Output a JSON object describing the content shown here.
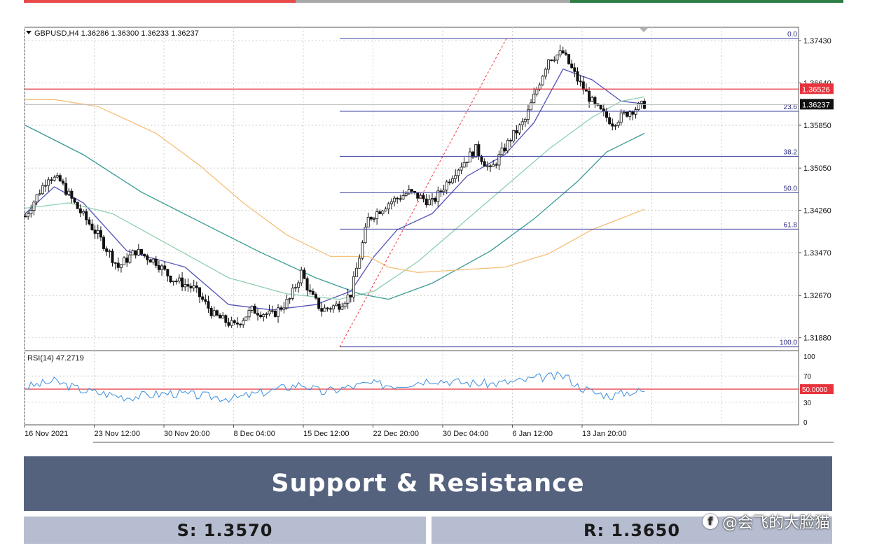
{
  "colors": {
    "top_red": "#e84a4a",
    "top_gray": "#a8a8a8",
    "top_green": "#2e7d46",
    "banner_bg": "#54627e",
    "sr_bg": "#b6bdd0",
    "fib_line": "#3b3fa0",
    "resistance_line": "#e8323c",
    "ma_fast": "#5252b8",
    "ma_mid": "#8ed0b0",
    "ma_slow": "#3a9a94",
    "ma_200": "#f5c07a",
    "rsi_line": "#3d8fdc"
  },
  "chart_data": {
    "type": "candlestick",
    "symbol_header": "GBPUSD,H4  1.36286 1.36300 1.36233 1.36237",
    "price_axis": {
      "ylim": [
        1.3164,
        1.3768
      ],
      "ticks": [
        "1.37430",
        "1.36640",
        "1.35850",
        "1.35050",
        "1.34260",
        "1.33470",
        "1.32670",
        "1.31880"
      ],
      "tick_values": [
        1.3743,
        1.3664,
        1.3585,
        1.3505,
        1.3426,
        1.3347,
        1.3267,
        1.3188
      ]
    },
    "current_price": {
      "label": "1.36237",
      "value": 1.36237
    },
    "horizontal_level": {
      "label": "1.36526",
      "value": 1.36526
    },
    "fibonacci": {
      "high": 1.3747,
      "low": 1.3171,
      "levels": [
        {
          "label": "0.0",
          "ratio": 0.0
        },
        {
          "label": "23.6",
          "ratio": 0.236
        },
        {
          "label": "38.2",
          "ratio": 0.382
        },
        {
          "label": "50.0",
          "ratio": 0.5
        },
        {
          "label": "61.8",
          "ratio": 0.618
        },
        {
          "label": "100.0",
          "ratio": 1.0
        }
      ]
    },
    "time_axis": {
      "labels": [
        "16 Nov 2021",
        "23 Nov 12:00",
        "30 Nov 20:00",
        "8 Dec 04:00",
        "15 Dec 12:00",
        "22 Dec 20:00",
        "30 Dec 04:00",
        "6 Jan 12:00",
        "13 Jan 20:00"
      ]
    },
    "candle_count": 175,
    "close_path": [
      [
        0,
        1.3415
      ],
      [
        8,
        1.349
      ],
      [
        12,
        1.348
      ],
      [
        18,
        1.343
      ],
      [
        25,
        1.338
      ],
      [
        32,
        1.332
      ],
      [
        38,
        1.335
      ],
      [
        45,
        1.333
      ],
      [
        50,
        1.33
      ],
      [
        58,
        1.328
      ],
      [
        65,
        1.323
      ],
      [
        72,
        1.321
      ],
      [
        78,
        1.324
      ],
      [
        85,
        1.323
      ],
      [
        91,
        1.326
      ],
      [
        95,
        1.331
      ],
      [
        98,
        1.327
      ],
      [
        102,
        1.324
      ],
      [
        108,
        1.325
      ],
      [
        112,
        1.327
      ],
      [
        118,
        1.341
      ],
      [
        125,
        1.344
      ],
      [
        132,
        1.346
      ],
      [
        140,
        1.344
      ],
      [
        148,
        1.35
      ],
      [
        155,
        1.354
      ],
      [
        160,
        1.35
      ],
      [
        167,
        1.356
      ],
      [
        172,
        1.3595
      ],
      [
        180,
        1.371
      ],
      [
        185,
        1.372
      ],
      [
        190,
        1.367
      ],
      [
        196,
        1.362
      ],
      [
        202,
        1.359
      ],
      [
        208,
        1.3612
      ],
      [
        213,
        1.3624
      ]
    ],
    "moving_averages": [
      {
        "key": "ma_fast",
        "points": [
          [
            0,
            1.342
          ],
          [
            10,
            1.347
          ],
          [
            20,
            1.344
          ],
          [
            35,
            1.335
          ],
          [
            55,
            1.332
          ],
          [
            70,
            1.325
          ],
          [
            85,
            1.324
          ],
          [
            100,
            1.325
          ],
          [
            112,
            1.3275
          ],
          [
            120,
            1.334
          ],
          [
            128,
            1.339
          ],
          [
            140,
            1.342
          ],
          [
            152,
            1.349
          ],
          [
            165,
            1.353
          ],
          [
            175,
            1.359
          ],
          [
            185,
            1.369
          ],
          [
            195,
            1.367
          ],
          [
            205,
            1.363
          ],
          [
            213,
            1.3625
          ]
        ]
      },
      {
        "key": "ma_mid",
        "points": [
          [
            0,
            1.343
          ],
          [
            15,
            1.344
          ],
          [
            30,
            1.342
          ],
          [
            50,
            1.336
          ],
          [
            70,
            1.33
          ],
          [
            90,
            1.327
          ],
          [
            108,
            1.326
          ],
          [
            120,
            1.3275
          ],
          [
            135,
            1.333
          ],
          [
            150,
            1.34
          ],
          [
            165,
            1.347
          ],
          [
            180,
            1.354
          ],
          [
            195,
            1.36
          ],
          [
            205,
            1.363
          ],
          [
            213,
            1.3638
          ]
        ]
      },
      {
        "key": "ma_slow",
        "points": [
          [
            0,
            1.3585
          ],
          [
            20,
            1.353
          ],
          [
            40,
            1.346
          ],
          [
            60,
            1.3405
          ],
          [
            80,
            1.335
          ],
          [
            100,
            1.33
          ],
          [
            115,
            1.327
          ],
          [
            125,
            1.326
          ],
          [
            140,
            1.329
          ],
          [
            160,
            1.335
          ],
          [
            175,
            1.341
          ],
          [
            190,
            1.348
          ],
          [
            200,
            1.3535
          ],
          [
            213,
            1.357
          ]
        ]
      },
      {
        "key": "ma_200",
        "points": [
          [
            0,
            1.3633
          ],
          [
            10,
            1.3633
          ],
          [
            25,
            1.362
          ],
          [
            45,
            1.357
          ],
          [
            60,
            1.351
          ],
          [
            75,
            1.344
          ],
          [
            90,
            1.338
          ],
          [
            105,
            1.334
          ],
          [
            118,
            1.334
          ],
          [
            125,
            1.332
          ],
          [
            135,
            1.331
          ],
          [
            150,
            1.3315
          ],
          [
            165,
            1.332
          ],
          [
            180,
            1.3345
          ],
          [
            195,
            1.339
          ],
          [
            213,
            1.3428
          ]
        ]
      }
    ],
    "rsi": {
      "header": "RSI(14) 47.2719",
      "value": 47.2719,
      "ylim": [
        0,
        100
      ],
      "ticks": [
        "100",
        "70",
        "30",
        "0"
      ],
      "tick_values": [
        100,
        70,
        30,
        0
      ],
      "level_label": "50.0000",
      "level_value": 50,
      "path": [
        [
          0,
          53
        ],
        [
          10,
          62
        ],
        [
          20,
          48
        ],
        [
          35,
          38
        ],
        [
          50,
          44
        ],
        [
          60,
          40
        ],
        [
          72,
          36
        ],
        [
          85,
          48
        ],
        [
          95,
          58
        ],
        [
          102,
          45
        ],
        [
          110,
          52
        ],
        [
          118,
          58
        ],
        [
          128,
          56
        ],
        [
          140,
          65
        ],
        [
          150,
          60
        ],
        [
          160,
          58
        ],
        [
          170,
          62
        ],
        [
          178,
          68
        ],
        [
          186,
          70
        ],
        [
          190,
          55
        ],
        [
          196,
          44
        ],
        [
          202,
          40
        ],
        [
          208,
          46
        ],
        [
          213,
          47
        ]
      ]
    }
  },
  "banner": {
    "title": "Support & Resistance"
  },
  "levels": {
    "support": "S: 1.3570",
    "resistance": "R: 1.3650"
  },
  "watermark": {
    "text": "@会飞的大脸猫"
  }
}
